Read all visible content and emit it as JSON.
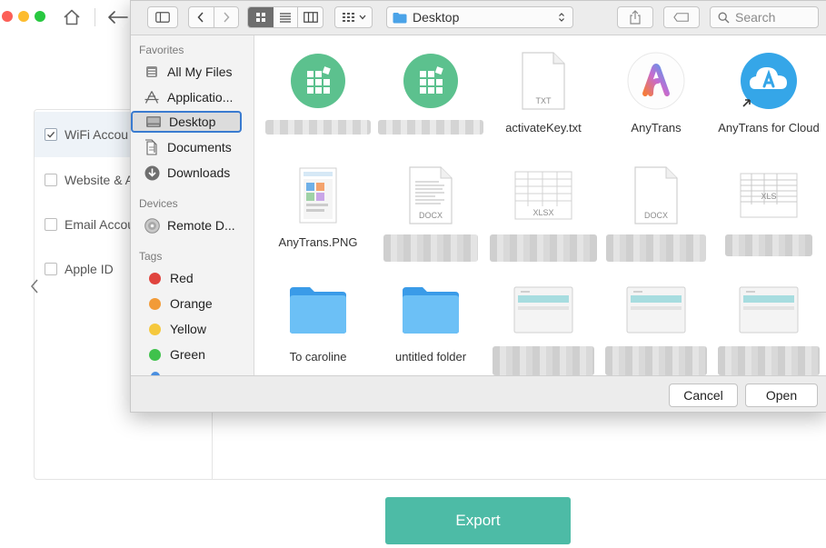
{
  "app": {
    "categories": [
      {
        "label": "WiFi Accou",
        "checked": true
      },
      {
        "label": "Website & A",
        "checked": false
      },
      {
        "label": "Email Accou",
        "checked": false
      },
      {
        "label": "Apple ID",
        "checked": false
      }
    ],
    "export_label": "Export",
    "colors": {
      "accent": "#4dbba6",
      "close": "#fc5f57",
      "minimize": "#fdbc2e",
      "zoom": "#28c840"
    }
  },
  "dialog": {
    "location": "Desktop",
    "search_placeholder": "Search",
    "sidebar": {
      "favorites_header": "Favorites",
      "favorites": [
        {
          "label": "All My Files",
          "icon": "all-files-icon"
        },
        {
          "label": "Applicatio...",
          "icon": "applications-icon"
        },
        {
          "label": "Desktop",
          "icon": "desktop-icon",
          "selected": true
        },
        {
          "label": "Documents",
          "icon": "documents-icon"
        },
        {
          "label": "Downloads",
          "icon": "downloads-icon"
        }
      ],
      "devices_header": "Devices",
      "devices": [
        {
          "label": "Remote D...",
          "icon": "remote-disc-icon"
        }
      ],
      "tags_header": "Tags",
      "tags": [
        {
          "label": "Red",
          "color": "#e0443e"
        },
        {
          "label": "Orange",
          "color": "#f29b38"
        },
        {
          "label": "Yellow",
          "color": "#f5c83d"
        },
        {
          "label": "Green",
          "color": "#3fc24c"
        }
      ]
    },
    "files": [
      {
        "name": "",
        "icon": "green-app-icon"
      },
      {
        "name": "",
        "icon": "green-app-icon"
      },
      {
        "name": "activateKey.txt",
        "icon": "txt-file-icon",
        "badge": "TXT"
      },
      {
        "name": "AnyTrans",
        "icon": "anytrans-app-icon"
      },
      {
        "name": "AnyTrans for Cloud",
        "icon": "anytrans-cloud-icon"
      },
      {
        "name": "AnyTrans.PNG",
        "icon": "png-file-icon"
      },
      {
        "name": "",
        "icon": "docx-file-icon",
        "badge": "DOCX"
      },
      {
        "name": "",
        "icon": "xlsx-file-icon",
        "badge": "XLSX"
      },
      {
        "name": "",
        "icon": "docx-file-icon",
        "badge": "DOCX"
      },
      {
        "name": "",
        "icon": "xls-file-icon",
        "badge": "XLS"
      },
      {
        "name": "To caroline",
        "icon": "folder-icon"
      },
      {
        "name": "untitled folder",
        "icon": "folder-icon"
      },
      {
        "name": "",
        "icon": "screenshot-thumb-icon"
      },
      {
        "name": "",
        "icon": "screenshot-thumb-icon"
      },
      {
        "name": "",
        "icon": "screenshot-thumb-icon"
      }
    ],
    "cancel_label": "Cancel",
    "open_label": "Open"
  }
}
